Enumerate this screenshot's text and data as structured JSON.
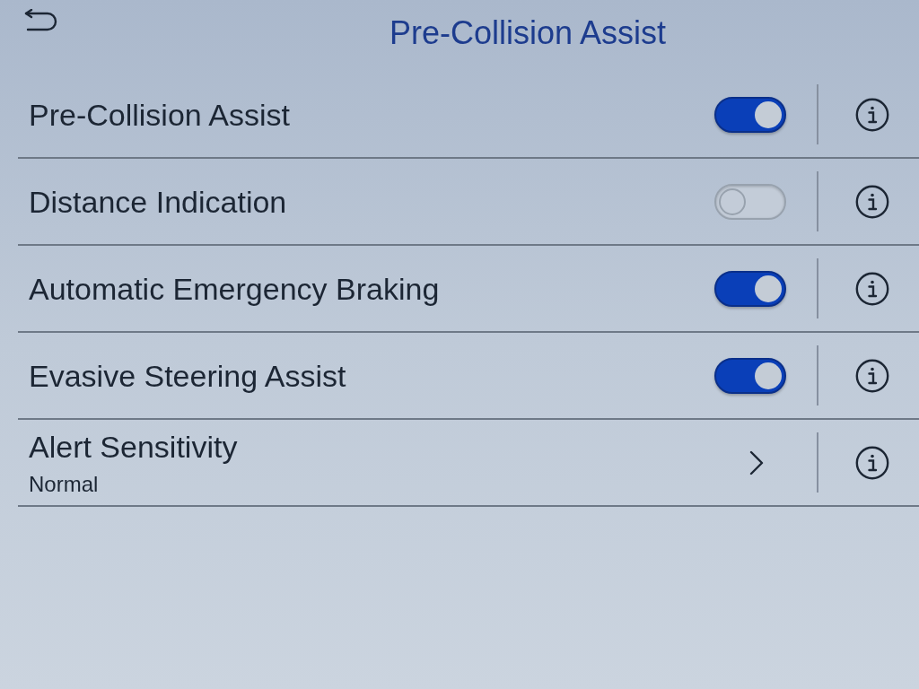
{
  "header": {
    "title": "Pre-Collision Assist"
  },
  "rows": [
    {
      "kind": "toggle",
      "label": "Pre-Collision Assist",
      "on": true
    },
    {
      "kind": "toggle",
      "label": "Distance Indication",
      "on": false
    },
    {
      "kind": "toggle",
      "label": "Automatic Emergency Braking",
      "on": true
    },
    {
      "kind": "toggle",
      "label": "Evasive Steering Assist",
      "on": true
    },
    {
      "kind": "link",
      "label": "Alert Sensitivity",
      "value": "Normal"
    }
  ]
}
